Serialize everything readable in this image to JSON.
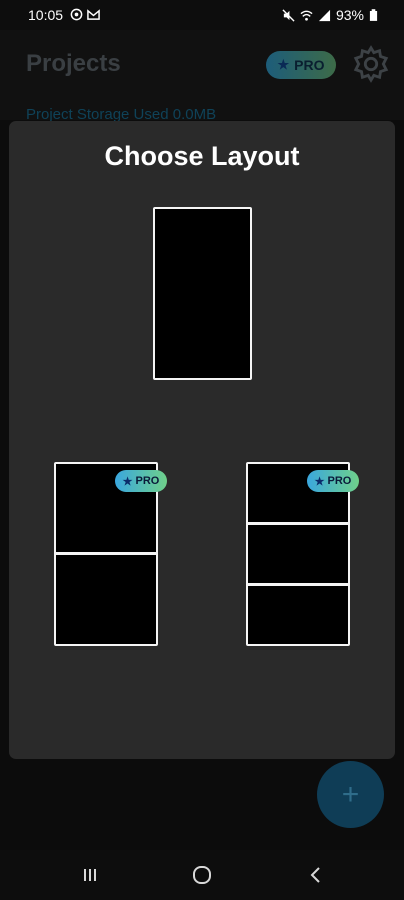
{
  "status_bar": {
    "time": "10:05",
    "battery": "93%",
    "icons": [
      "target-icon",
      "mail-icon",
      "mute-icon",
      "wifi-icon",
      "signal-icon",
      "battery-icon"
    ]
  },
  "header": {
    "title": "Projects",
    "pro_label": "PRO",
    "storage_text": "Project Storage Used 0.0MB"
  },
  "dialog": {
    "title": "Choose Layout",
    "options": [
      {
        "name": "single",
        "panels": 1,
        "pro": false
      },
      {
        "name": "two-panel",
        "panels": 2,
        "pro": true,
        "pro_label": "PRO"
      },
      {
        "name": "three-panel",
        "panels": 3,
        "pro": true,
        "pro_label": "PRO"
      }
    ]
  },
  "fab": {
    "label": "+"
  },
  "colors": {
    "background": "#0c0c0c",
    "dialog": "#2a2a2a",
    "pro_gradient_start": "#3aa7de",
    "pro_gradient_end": "#6fd08a",
    "fab": "#0f3d56"
  },
  "nav": {
    "buttons": [
      "recents-icon",
      "home-icon",
      "back-icon"
    ]
  }
}
